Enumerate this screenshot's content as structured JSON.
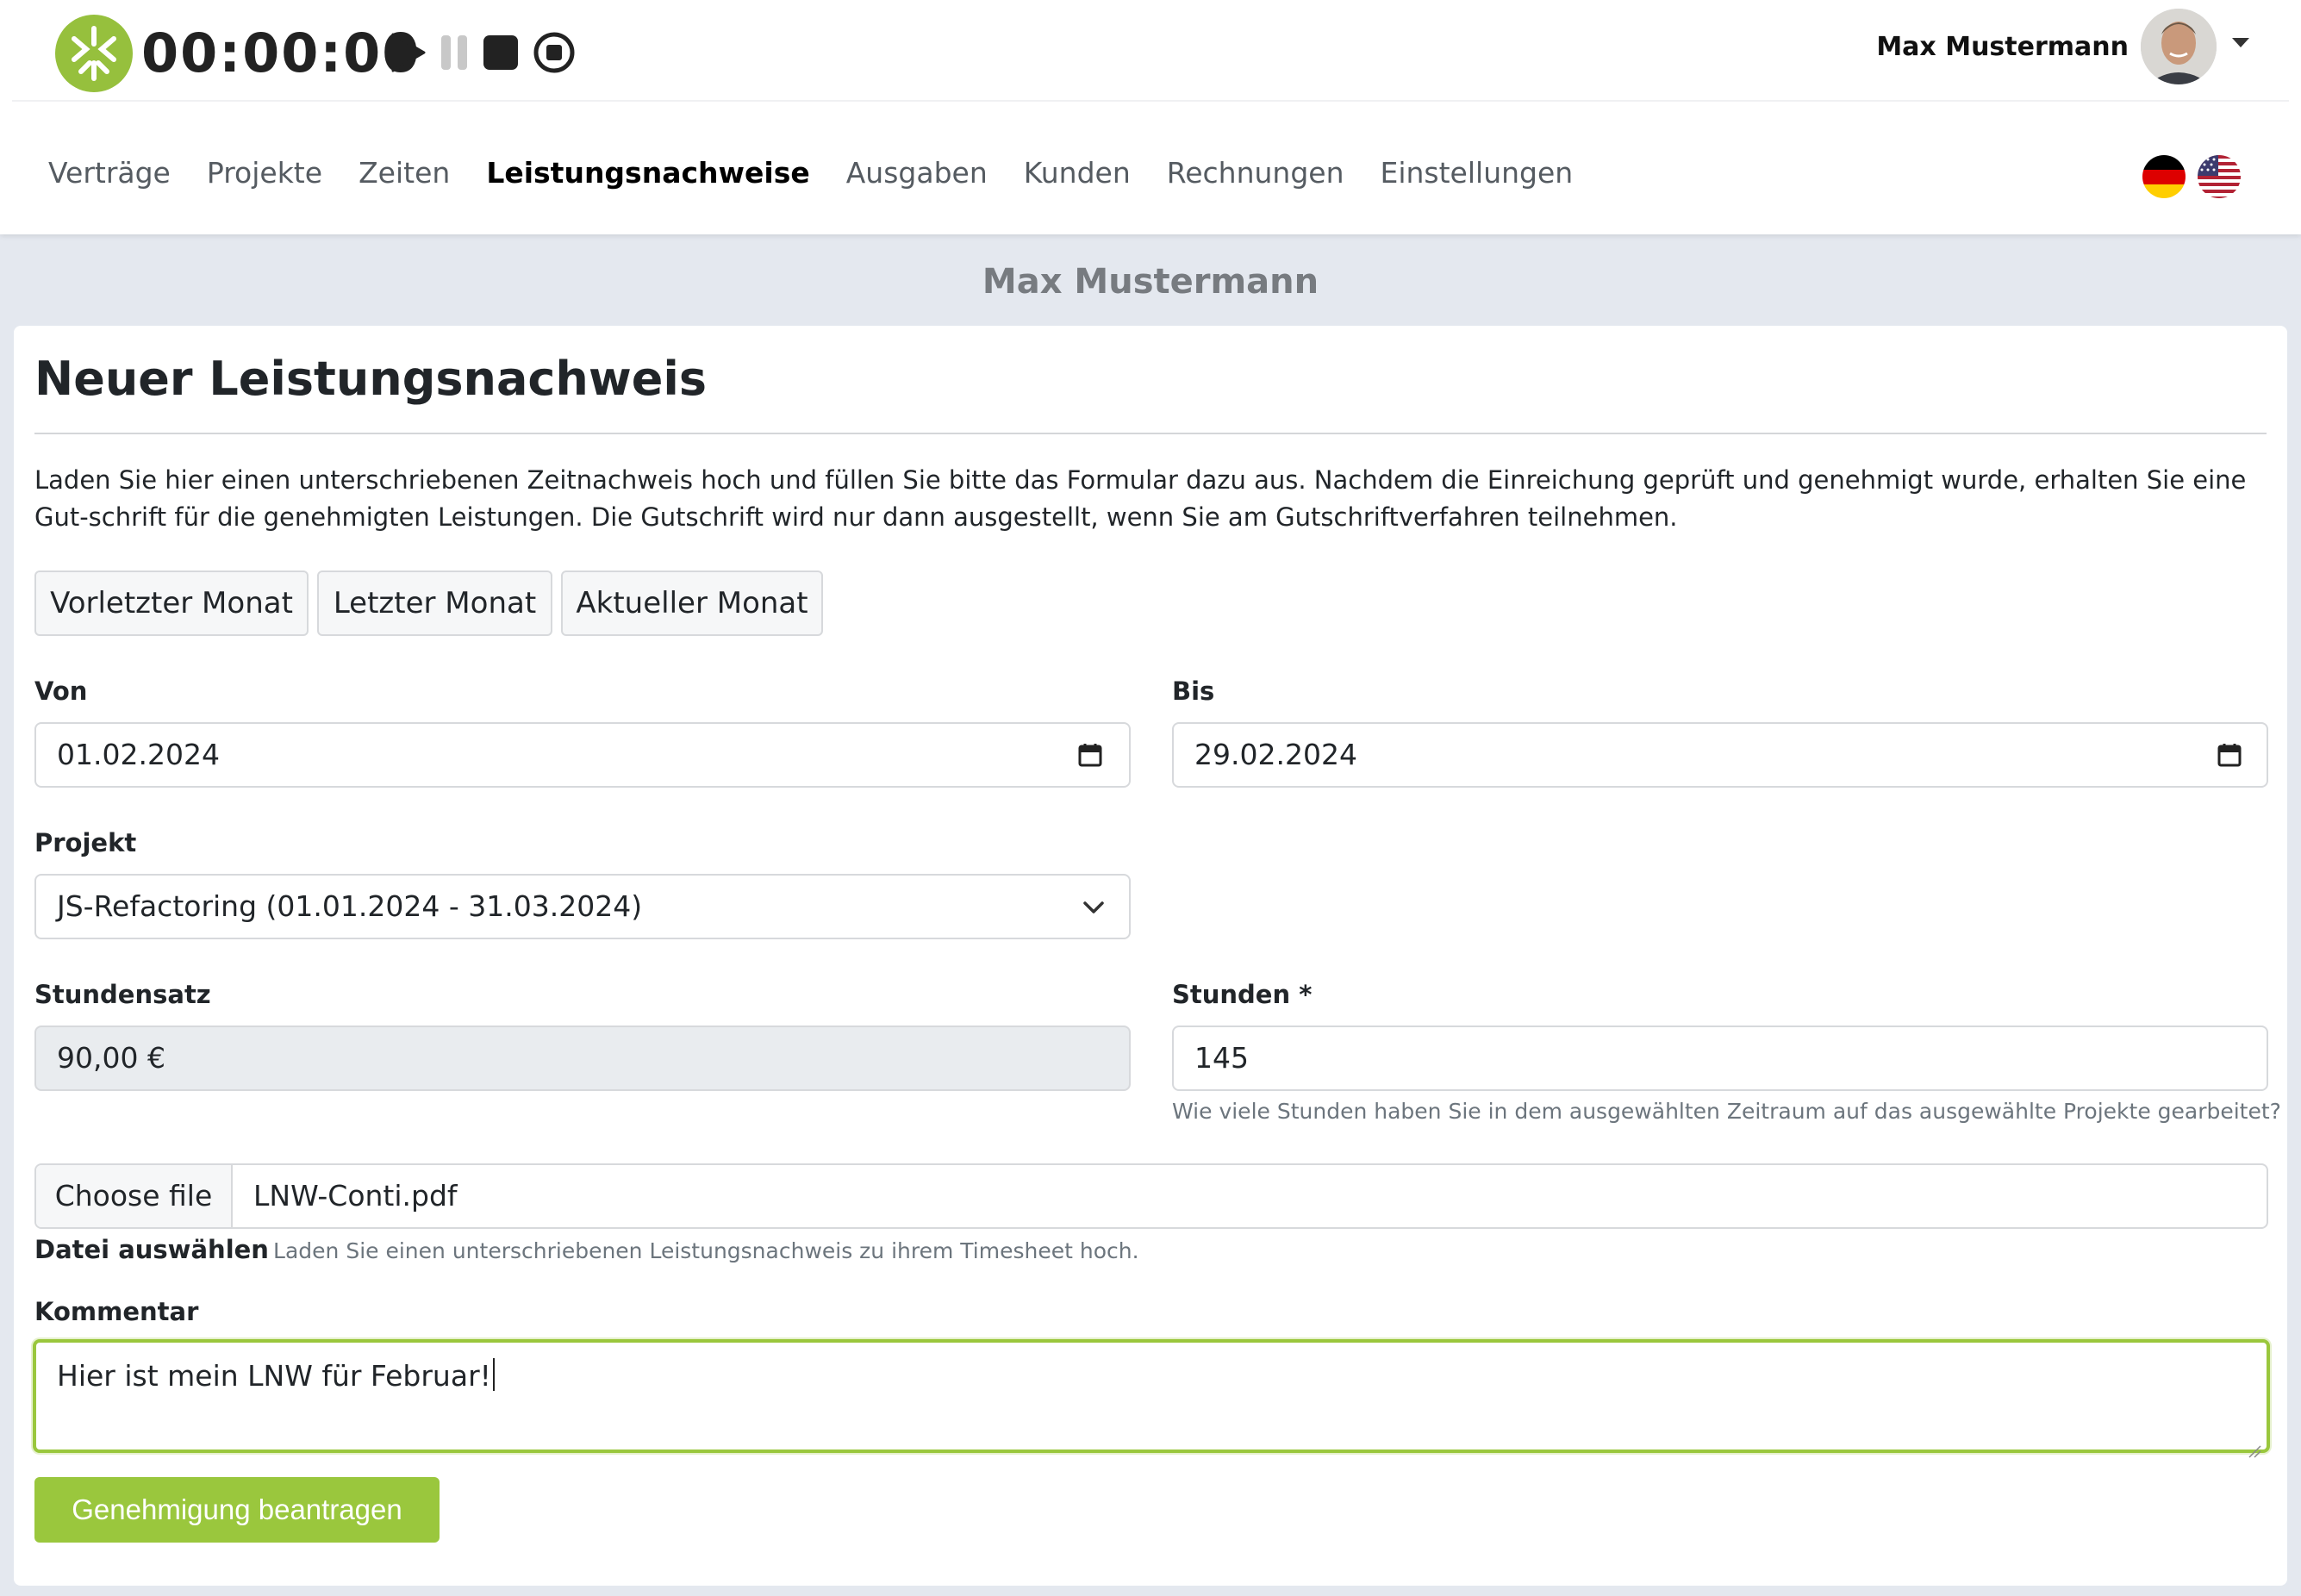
{
  "header": {
    "timer": "00:00:00",
    "user_name": "Max Mustermann"
  },
  "nav": {
    "items": [
      "Verträge",
      "Projekte",
      "Zeiten",
      "Leistungsnachweise",
      "Ausgaben",
      "Kunden",
      "Rechnungen",
      "Einstellungen"
    ],
    "active": "Leistungsnachweise"
  },
  "page": {
    "owner": "Max Mustermann",
    "title": "Neuer Leistungsnachweis",
    "intro": "Laden Sie hier einen unterschriebenen Zeitnachweis hoch und füllen Sie bitte das Formular dazu aus. Nachdem die Einreichung geprüft und genehmigt wurde, erhalten Sie eine Gut-schrift für die genehmigten Leistungen. Die Gutschrift wird nur dann ausgestellt, wenn Sie am Gutschriftverfahren teilnehmen."
  },
  "quick_buttons": {
    "prev_prev": "Vorletzter Monat",
    "prev": "Letzter Monat",
    "current": "Aktueller Monat"
  },
  "form": {
    "von_label": "Von",
    "von_value": "01.02.2024",
    "bis_label": "Bis",
    "bis_value": "29.02.2024",
    "projekt_label": "Projekt",
    "projekt_value": "JS-Refactoring (01.01.2024 - 31.03.2024)",
    "stundensatz_label": "Stundensatz",
    "stundensatz_value": "90,00 €",
    "stunden_label": "Stunden *",
    "stunden_value": "145",
    "stunden_help": "Wie viele Stunden haben Sie in dem ausgewählten Zeitraum auf das ausgewählte Projekte gearbeitet?",
    "file_button": "Choose file",
    "file_name": "LNW-Conti.pdf",
    "file_label": "Datei auswählen",
    "file_help": "Laden Sie einen unterschriebenen Leistungsnachweis zu ihrem Timesheet hoch.",
    "kommentar_label": "Kommentar",
    "kommentar_value": "Hier ist mein LNW für Februar!",
    "submit": "Genehmigung beantragen"
  },
  "colors": {
    "accent": "#9ac73d",
    "page_bg": "#e4e8ef"
  }
}
